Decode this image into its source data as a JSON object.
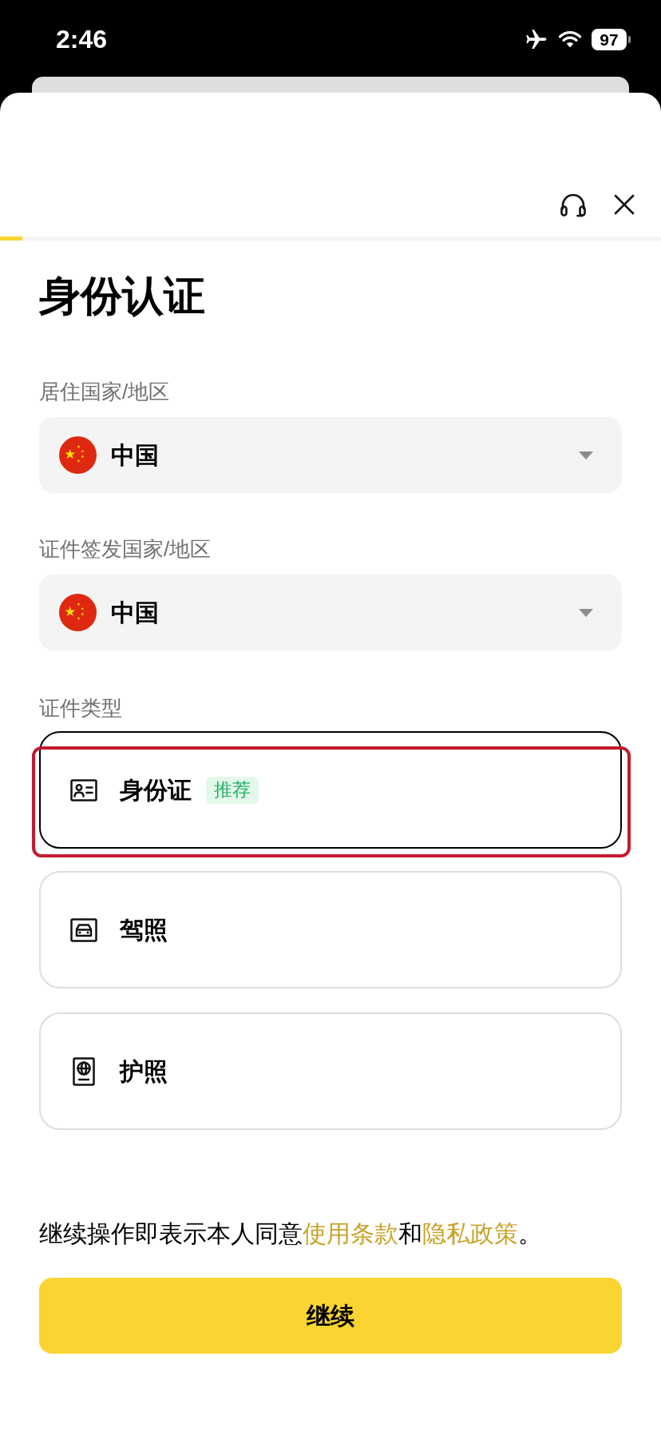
{
  "status_bar": {
    "time": "2:46",
    "battery": "97"
  },
  "progress": {
    "level": 0.034
  },
  "title": "身份认证",
  "fields": [
    {
      "label": "居住国家/地区",
      "value": "中国"
    },
    {
      "label": "证件签发国家/地区",
      "value": "中国"
    }
  ],
  "document_type": {
    "label": "证件类型",
    "options": [
      {
        "kind": "id_card",
        "label": "身份证",
        "badge": "推荐",
        "selected": true,
        "highlighted": true
      },
      {
        "kind": "driver_license",
        "label": "驾照",
        "selected": false,
        "highlighted": false
      },
      {
        "kind": "passport",
        "label": "护照",
        "selected": false,
        "highlighted": false
      }
    ]
  },
  "terms": [
    {
      "kind": "text",
      "text": "继续操作即表示本人同意"
    },
    {
      "kind": "link",
      "text": "使用条款"
    },
    {
      "kind": "text",
      "text": "和"
    },
    {
      "kind": "link",
      "text": "隐私政策"
    },
    {
      "kind": "text",
      "text": "。"
    }
  ],
  "continue_button": {
    "label": "继续"
  }
}
